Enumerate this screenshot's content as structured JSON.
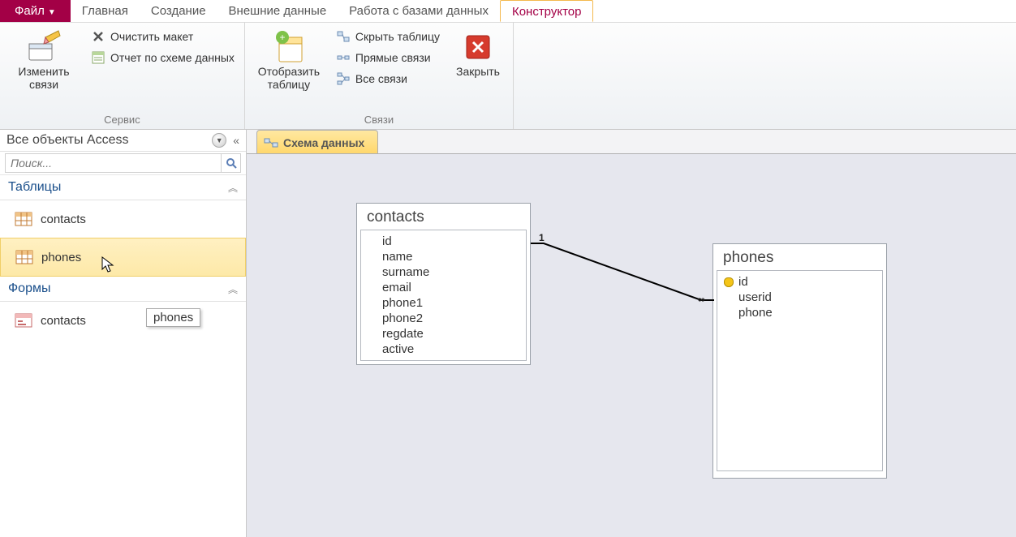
{
  "tabs": {
    "file": "Файл",
    "home": "Главная",
    "create": "Создание",
    "external": "Внешние данные",
    "dbtools": "Работа с базами данных",
    "designer": "Конструктор"
  },
  "ribbon": {
    "group_service": "Сервис",
    "group_rel": "Связи",
    "edit_rel": "Изменить связи",
    "clear_layout": "Очистить макет",
    "rel_report": "Отчет по схеме данных",
    "show_table": "Отобразить таблицу",
    "hide_table": "Скрыть таблицу",
    "direct_rel": "Прямые связи",
    "all_rel": "Все связи",
    "close": "Закрыть"
  },
  "nav": {
    "title": "Все объекты Access",
    "search_placeholder": "Поиск...",
    "cat_tables": "Таблицы",
    "cat_forms": "Формы",
    "tables": [
      "contacts",
      "phones"
    ],
    "forms": [
      "contacts"
    ],
    "tooltip": "phones"
  },
  "doc_tab": "Схема данных",
  "diagram": {
    "table1": {
      "name": "contacts",
      "fields": [
        "id",
        "name",
        "surname",
        "email",
        "phone1",
        "phone2",
        "regdate",
        "active"
      ]
    },
    "table2": {
      "name": "phones",
      "fields": [
        "id",
        "userid",
        "phone"
      ],
      "key_field_index": 0
    },
    "cardinality": {
      "left": "1",
      "right": "∞"
    }
  }
}
